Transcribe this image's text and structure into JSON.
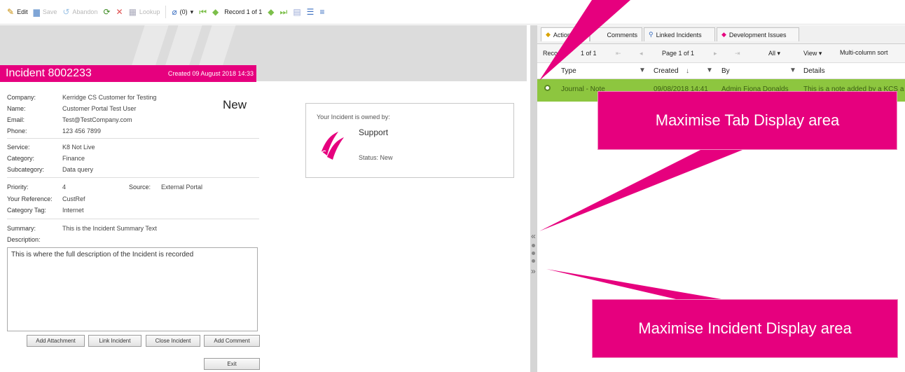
{
  "toolbar": {
    "edit": "Edit",
    "save": "Save",
    "abandon": "Abandon",
    "lookup": "Lookup",
    "attachments": "(0)",
    "record": "Record 1 of 1"
  },
  "incident": {
    "title": "Incident 8002233",
    "created": "Created 09 August 2018 14:33",
    "status": "New",
    "company_label": "Company:",
    "company": "Kerridge CS Customer for Testing",
    "name_label": "Name:",
    "name": "Customer Portal Test User",
    "email_label": "Email:",
    "email": "Test@TestCompany.com",
    "phone_label": "Phone:",
    "phone": "123 456 7899",
    "service_label": "Service:",
    "service": "K8 Not Live",
    "category_label": "Category:",
    "category": "Finance",
    "subcategory_label": "Subcategory:",
    "subcategory": "Data query",
    "priority_label": "Priority:",
    "priority": "4",
    "source_label": "Source:",
    "source": "External Portal",
    "reference_label": "Your Reference:",
    "reference": "CustRef",
    "category_tag_label": "Category Tag:",
    "category_tag": "Internet",
    "summary_label": "Summary:",
    "summary": "This is the Incident Summary Text",
    "description_label": "Description:",
    "description": "This is where the full description of the Incident is recorded"
  },
  "buttons": {
    "add_attachment": "Add Attachment",
    "link_incident": "Link Incident",
    "close_incident": "Close Incident",
    "add_comment": "Add Comment",
    "exit": "Exit"
  },
  "owner": {
    "heading": "Your Incident is owned by:",
    "team": "Support",
    "status": "Status: New"
  },
  "tabs": [
    {
      "label": "Actions"
    },
    {
      "label": "Comments"
    },
    {
      "label": "Linked Incidents"
    },
    {
      "label": "Development Issues"
    }
  ],
  "grid": {
    "records_prefix": "Reco",
    "records_suffix": "1 of 1",
    "page": "Page 1 of 1",
    "all": "All",
    "view": "View",
    "multisort": "Multi-column sort",
    "columns": [
      "Type",
      "Created",
      "By",
      "Details"
    ],
    "row": {
      "type": "Journal - Note",
      "created": "09/08/2018 14:41",
      "by": "Admin Fiona Donalds",
      "details": "This is a note added by a KCS a"
    }
  },
  "callouts": {
    "tab_area": "Maximise Tab Display area",
    "incident_area": "Maximise Incident Display area"
  },
  "colors": {
    "accent": "#e6007e",
    "row_highlight": "#8dc63f"
  }
}
